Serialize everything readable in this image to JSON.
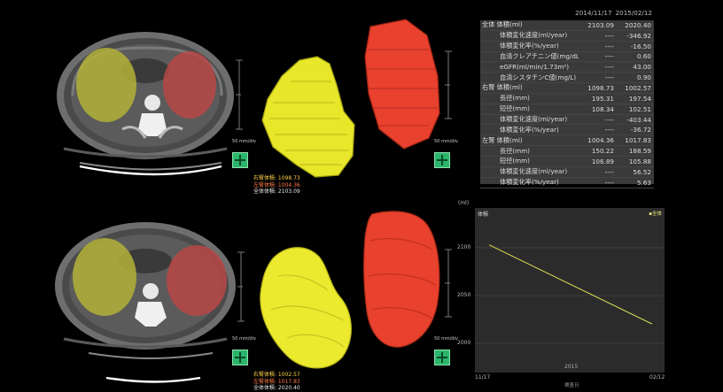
{
  "date_header": {
    "d1": "2014/11/17",
    "d2": "2015/02/12"
  },
  "scale": {
    "unit": "50",
    "unit_label": "mm/div"
  },
  "legend_top": {
    "right": "右腎体積: 1098.73",
    "left": "左腎体積: 1004.36",
    "total": "全体体積: 2103.09"
  },
  "legend_bottom": {
    "right": "右腎体積: 1002.57",
    "left": "左腎体積: 1017.83",
    "total": "全体体積: 2020.40"
  },
  "table": [
    {
      "label": "全体 体積(ml)",
      "v1": "2103.09",
      "v2": "2020.40",
      "sub": false
    },
    {
      "label": "体積変化速度(ml/year)",
      "v1": "----",
      "v2": "-346.92",
      "sub": true
    },
    {
      "label": "体積変化率(%/year)",
      "v1": "----",
      "v2": "-16.50",
      "sub": true
    },
    {
      "label": "血清クレアチニン値(mg/dL)",
      "v1": "----",
      "v2": "0.60",
      "sub": true
    },
    {
      "label": "eGFR(ml/min/1.73m²)",
      "v1": "----",
      "v2": "43.00",
      "sub": true
    },
    {
      "label": "血清シスタチンC値(mg/L)",
      "v1": "----",
      "v2": "0.90",
      "sub": true
    },
    {
      "label": "右腎 体積(ml)",
      "v1": "1098.73",
      "v2": "1002.57",
      "sub": false
    },
    {
      "label": "長径(mm)",
      "v1": "195.31",
      "v2": "197.54",
      "sub": true
    },
    {
      "label": "短径(mm)",
      "v1": "108.34",
      "v2": "102.51",
      "sub": true
    },
    {
      "label": "体積変化速度(ml/year)",
      "v1": "----",
      "v2": "-403.44",
      "sub": true
    },
    {
      "label": "体積変化率(%/year)",
      "v1": "----",
      "v2": "-36.72",
      "sub": true
    },
    {
      "label": "左腎 体積(ml)",
      "v1": "1004.36",
      "v2": "1017.83",
      "sub": false
    },
    {
      "label": "長径(mm)",
      "v1": "150.22",
      "v2": "188.59",
      "sub": true
    },
    {
      "label": "短径(mm)",
      "v1": "106.89",
      "v2": "105.88",
      "sub": true
    },
    {
      "label": "体積変化速度(ml/year)",
      "v1": "----",
      "v2": "56.52",
      "sub": true
    },
    {
      "label": "体積変化率(%/year)",
      "v1": "----",
      "v2": "5.63",
      "sub": true
    }
  ],
  "chart_data": {
    "type": "line",
    "title": "体積",
    "ylabel": "(ml)",
    "xlabel": "検査日",
    "categories": [
      "11/17",
      "02/12"
    ],
    "year_label": "2015",
    "yticks": [
      2000,
      2050,
      2100
    ],
    "ylim": [
      1990,
      2125
    ],
    "series": [
      {
        "name": "全体",
        "values": [
          2103.09,
          2020.4
        ],
        "color": "#d9dd55"
      }
    ]
  }
}
